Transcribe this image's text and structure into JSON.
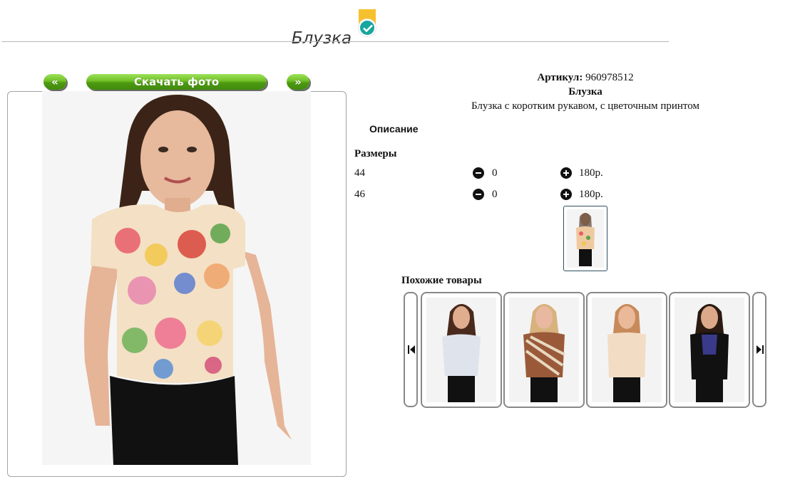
{
  "product": {
    "title": "Блузка",
    "sku_label": "Артикул:",
    "sku_value": "960978512",
    "name": "Блузка",
    "description": "Блузка с коротким рукавом, с цветочным принтом"
  },
  "buttons": {
    "prev": "«",
    "download": "Скачать фото",
    "next": "»"
  },
  "description_heading": "Описание",
  "sizes_heading": "Размеры",
  "sizes": [
    {
      "size": "44",
      "qty": "0",
      "price": "180р."
    },
    {
      "size": "46",
      "qty": "0",
      "price": "180р."
    }
  ],
  "similar_heading": "Похожие товары",
  "similar_items": [
    {
      "image": "woman-white-off-shoulder-blouse"
    },
    {
      "image": "woman-striped-brown-shirt"
    },
    {
      "image": "woman-beige-top"
    },
    {
      "image": "woman-black-blouse-lace"
    }
  ],
  "icons": {
    "verified": "check-badge-icon",
    "minus": "minus-circle-icon",
    "plus": "plus-circle-icon",
    "carousel_prev": "skip-back-icon",
    "carousel_next": "skip-forward-icon"
  },
  "colors": {
    "button_green": "#6fbf26",
    "badge_teal": "#17a6a0",
    "badge_yellow": "#f6c12e"
  }
}
